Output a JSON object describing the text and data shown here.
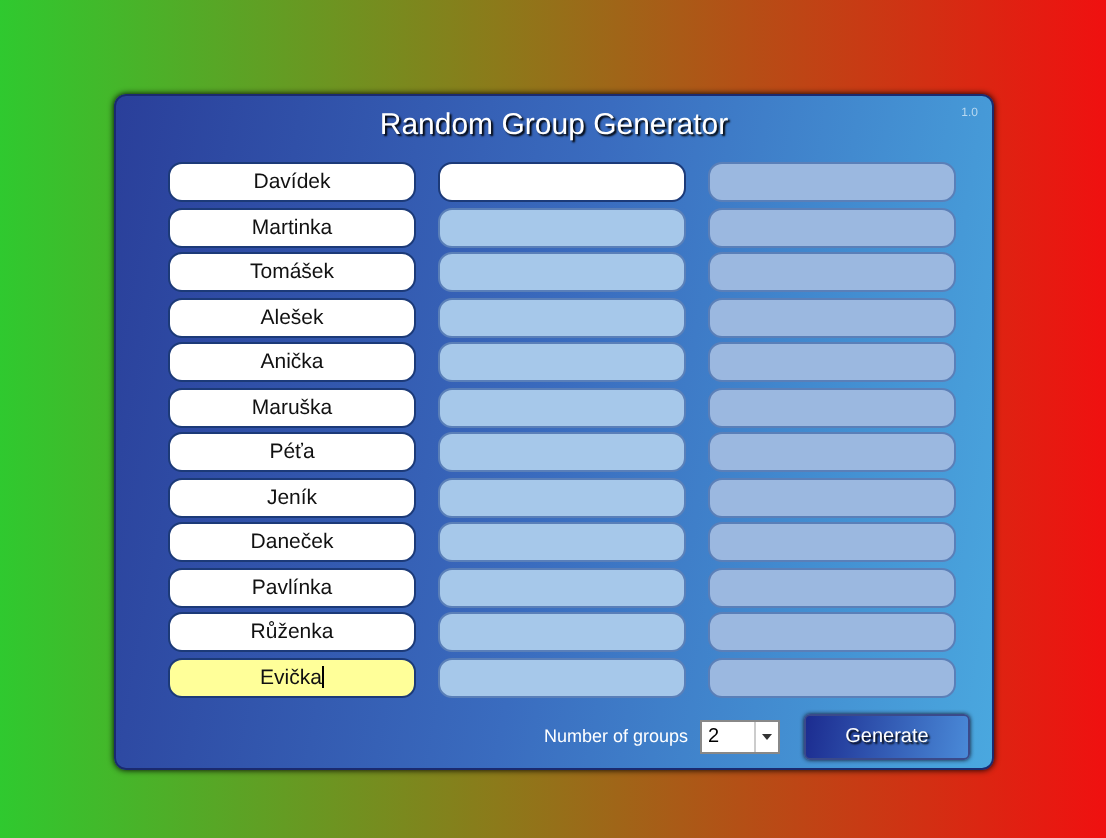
{
  "window": {
    "title": "Random Group Generator",
    "version": "1.0"
  },
  "columns": [
    {
      "fields": [
        {
          "value": "Davídek",
          "enabled": true,
          "focused": false
        },
        {
          "value": "Martinka",
          "enabled": true,
          "focused": false
        },
        {
          "value": "Tomášek",
          "enabled": true,
          "focused": false
        },
        {
          "value": "Alešek",
          "enabled": true,
          "focused": false
        },
        {
          "value": "Anička",
          "enabled": true,
          "focused": false
        },
        {
          "value": "Maruška",
          "enabled": true,
          "focused": false
        },
        {
          "value": "Péťa",
          "enabled": true,
          "focused": false
        },
        {
          "value": "Jeník",
          "enabled": true,
          "focused": false
        },
        {
          "value": "Daneček",
          "enabled": true,
          "focused": false
        },
        {
          "value": "Pavlínka",
          "enabled": true,
          "focused": false
        },
        {
          "value": "Růženka",
          "enabled": true,
          "focused": false
        },
        {
          "value": "Evička",
          "enabled": true,
          "focused": true
        }
      ]
    },
    {
      "fields": [
        {
          "enabled": true,
          "focused": false
        },
        {
          "enabled": false,
          "focused": false
        },
        {
          "enabled": false,
          "focused": false
        },
        {
          "enabled": false,
          "focused": false
        },
        {
          "enabled": false,
          "focused": false
        },
        {
          "enabled": false,
          "focused": false
        },
        {
          "enabled": false,
          "focused": false
        },
        {
          "enabled": false,
          "focused": false
        },
        {
          "enabled": false,
          "focused": false
        },
        {
          "enabled": false,
          "focused": false
        },
        {
          "enabled": false,
          "focused": false
        },
        {
          "enabled": false,
          "focused": false
        }
      ]
    },
    {
      "fields": [
        {
          "enabled": false,
          "focused": false
        },
        {
          "enabled": false,
          "focused": false
        },
        {
          "enabled": false,
          "focused": false
        },
        {
          "enabled": false,
          "focused": false
        },
        {
          "enabled": false,
          "focused": false
        },
        {
          "enabled": false,
          "focused": false
        },
        {
          "enabled": false,
          "focused": false
        },
        {
          "enabled": false,
          "focused": false
        },
        {
          "enabled": false,
          "focused": false
        },
        {
          "enabled": false,
          "focused": false
        },
        {
          "enabled": false,
          "focused": false
        },
        {
          "enabled": false,
          "focused": false
        }
      ]
    }
  ],
  "footer": {
    "groups_label": "Number of groups",
    "groups_value": "2",
    "button": "Generate"
  }
}
